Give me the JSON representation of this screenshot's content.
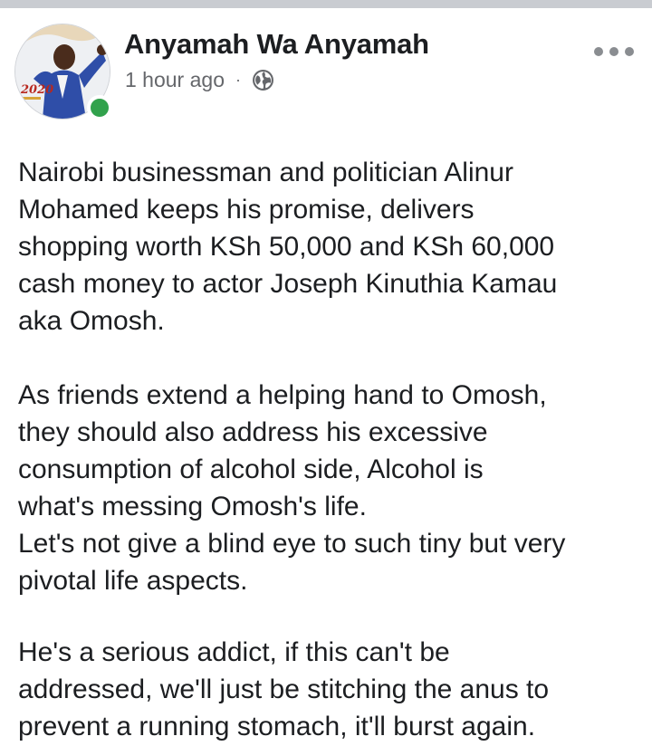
{
  "post": {
    "author": {
      "name": "Anyamah Wa Anyamah",
      "avatar_badge_text": "2020",
      "online": true
    },
    "timestamp": "1 hour ago",
    "separator": "·",
    "privacy_icon": "globe-icon",
    "menu_icon": "more-options-icon",
    "body": {
      "paragraph_1": [
        "Nairobi businessman and politician Alinur",
        "Mohamed keeps his promise, delivers",
        "shopping worth KSh 50,000 and KSh 60,000",
        "cash money to actor Joseph Kinuthia Kamau",
        "aka Omosh."
      ],
      "paragraph_2": [
        "As friends extend a helping hand to Omosh,",
        "they should also address his excessive",
        "consumption of alcohol side, Alcohol is",
        "what's messing Omosh's life.",
        "Let's not give a blind eye to such tiny but very",
        "pivotal life aspects."
      ],
      "paragraph_3": [
        "He's a serious addict, if this can't be",
        "addressed, we'll just be stitching the anus to",
        "prevent a running stomach, it'll burst again."
      ]
    }
  },
  "colors": {
    "online_indicator": "#31a24c",
    "secondary_text": "#65676b",
    "divider": "#c9ccd1"
  }
}
